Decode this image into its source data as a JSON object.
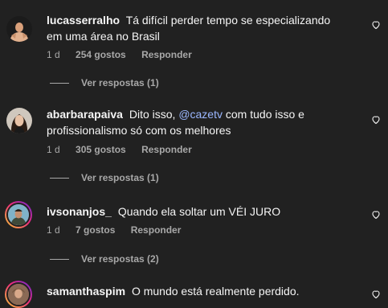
{
  "comments": [
    {
      "username": "lucasserralho",
      "text": "Tá difícil perder tempo se especializando em uma área no Brasil",
      "time": "1 d",
      "likes": "254 gostos",
      "reply": "Responder",
      "view_replies": "Ver respostas (1)"
    },
    {
      "username": "abarbarapaiva",
      "text_before": "Dito isso, ",
      "mention": "@cazetv",
      "text_after": " com tudo isso e profissionalismo só com os melhores",
      "time": "1 d",
      "likes": "305 gostos",
      "reply": "Responder",
      "view_replies": "Ver respostas (1)"
    },
    {
      "username": "ivsonanjos_",
      "text": "Quando ela soltar um VÉI JURO",
      "time": "1 d",
      "likes": "7 gostos",
      "reply": "Responder",
      "view_replies": "Ver respostas (2)"
    },
    {
      "username": "samanthaspim",
      "text": "O mundo está realmente perdido."
    }
  ],
  "icons": {
    "like": "heart-outline-icon"
  },
  "colors": {
    "background": "#212121",
    "text": "#f5f5f5",
    "secondary": "#a8a8a8",
    "mention": "#9bb7ff"
  }
}
